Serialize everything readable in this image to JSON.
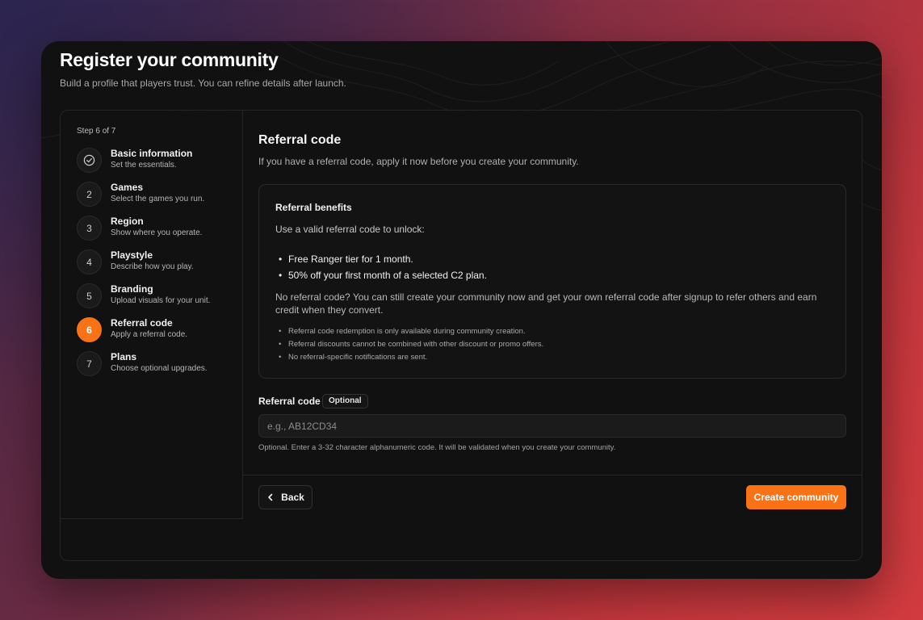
{
  "header": {
    "title": "Register your community",
    "subtitle": "Build a profile that players trust. You can refine details after launch."
  },
  "sidebar": {
    "step_counter": "Step 6 of 7",
    "steps": [
      {
        "number": "",
        "icon": "check-circle-icon",
        "title": "Basic information",
        "description": "Set the essentials.",
        "status": "complete"
      },
      {
        "number": "2",
        "title": "Games",
        "description": "Select the games you run.",
        "status": "upcoming"
      },
      {
        "number": "3",
        "title": "Region",
        "description": "Show where you operate.",
        "status": "upcoming"
      },
      {
        "number": "4",
        "title": "Playstyle",
        "description": "Describe how you play.",
        "status": "upcoming"
      },
      {
        "number": "5",
        "title": "Branding",
        "description": "Upload visuals for your unit.",
        "status": "upcoming"
      },
      {
        "number": "6",
        "title": "Referral code",
        "description": "Apply a referral code.",
        "status": "active"
      },
      {
        "number": "7",
        "title": "Plans",
        "description": "Choose optional upgrades.",
        "status": "upcoming"
      }
    ]
  },
  "main": {
    "title": "Referral code",
    "description": "If you have a referral code, apply it now before you create your community.",
    "benefits": {
      "title": "Referral benefits",
      "intro": "Use a valid referral code to unlock:",
      "items": [
        "Free Ranger tier for 1 month.",
        "50% off your first month of a selected C2 plan."
      ],
      "note": "No referral code? You can still create your community now and get your own referral code after signup to refer others and earn credit when they convert.",
      "fine_print": [
        "Referral code redemption is only available during community creation.",
        "Referral discounts cannot be combined with other discount or promo offers.",
        "No referral-specific notifications are sent."
      ]
    },
    "field": {
      "label": "Referral code",
      "badge": "Optional",
      "value": "",
      "placeholder": "e.g., AB12CD34",
      "helper": "Optional. Enter a 3-32 character alphanumeric code. It will be validated when you create your community."
    }
  },
  "footer": {
    "back_label": "Back",
    "create_label": "Create community"
  },
  "colors": {
    "accent": "#f97316",
    "window_bg": "#111111",
    "border": "#262626"
  }
}
